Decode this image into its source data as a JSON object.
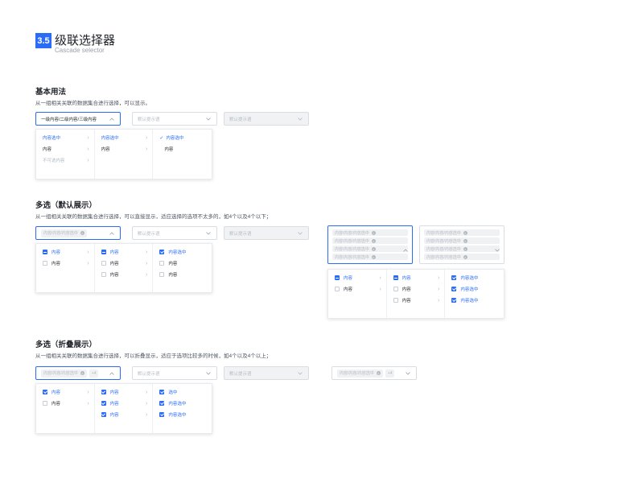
{
  "header": {
    "badge": "3.5",
    "title": "级联选择器",
    "subtitle": "Cascade selector"
  },
  "section1": {
    "title": "基本用法",
    "desc": "从一组相关关联的数据集合进行选择，可以显示。",
    "select1_value": "一级内容/二级内容/三级内容",
    "select2_placeholder": "默认提示语",
    "select3_placeholder": "默认提示语",
    "menu": {
      "col1": [
        {
          "label": "内容选中"
        },
        {
          "label": "内容"
        },
        {
          "label": "不可选内容"
        }
      ],
      "col2": [
        {
          "label": "内容选中"
        },
        {
          "label": "内容"
        }
      ],
      "col3": [
        {
          "label": "内容选中"
        },
        {
          "label": "内容"
        }
      ]
    }
  },
  "section2": {
    "title": "多选（默认展示）",
    "desc": "从一组相关关联的数据集合进行选择，可以直接显示，适应选择的选项不太多的，如4个以及4个以下；",
    "tag_label": "内容/内容/内容选中",
    "select2_placeholder": "默认提示语",
    "select3_placeholder": "默认提示语",
    "menu": {
      "col1": [
        {
          "label": "内容"
        },
        {
          "label": "内容"
        }
      ],
      "col2": [
        {
          "label": "内容"
        },
        {
          "label": "内容"
        },
        {
          "label": "内容"
        }
      ],
      "col3": [
        {
          "label": "内容选中"
        },
        {
          "label": "内容"
        },
        {
          "label": "内容"
        }
      ]
    },
    "menu_right": {
      "col1": [
        {
          "label": "内容"
        },
        {
          "label": "内容"
        }
      ],
      "col2": [
        {
          "label": "内容"
        },
        {
          "label": "内容"
        },
        {
          "label": "内容"
        }
      ],
      "col3": [
        {
          "label": "内容选中"
        },
        {
          "label": "内容选中"
        },
        {
          "label": "内容选中"
        }
      ]
    }
  },
  "section3": {
    "title": "多选（折叠展示）",
    "desc": "从一组相关关联的数据集合进行选择，可以折叠显示，适应于选项比较多的时候，如4个以及4个以上；",
    "tag_label": "内容/内容/内容选中",
    "more_count": "+4",
    "select2_placeholder": "默认提示语",
    "select3_placeholder": "默认提示语",
    "menu": {
      "col1": [
        {
          "label": "内容"
        },
        {
          "label": "内容"
        }
      ],
      "col2": [
        {
          "label": "内容"
        },
        {
          "label": "内容"
        },
        {
          "label": "内容"
        }
      ],
      "col3": [
        {
          "label": "选中"
        },
        {
          "label": "内容选中"
        },
        {
          "label": "内容选中"
        }
      ]
    }
  },
  "colors": {
    "accent": "#2b6cf6",
    "border": "#d9dde3",
    "disabled_bg": "#f1f2f4",
    "placeholder": "#b3b9c2"
  },
  "icons": {
    "arrow": "chevron-down-icon",
    "next": "chevron-right-icon",
    "check": "check-icon",
    "tag_close": "close-circle-icon"
  }
}
